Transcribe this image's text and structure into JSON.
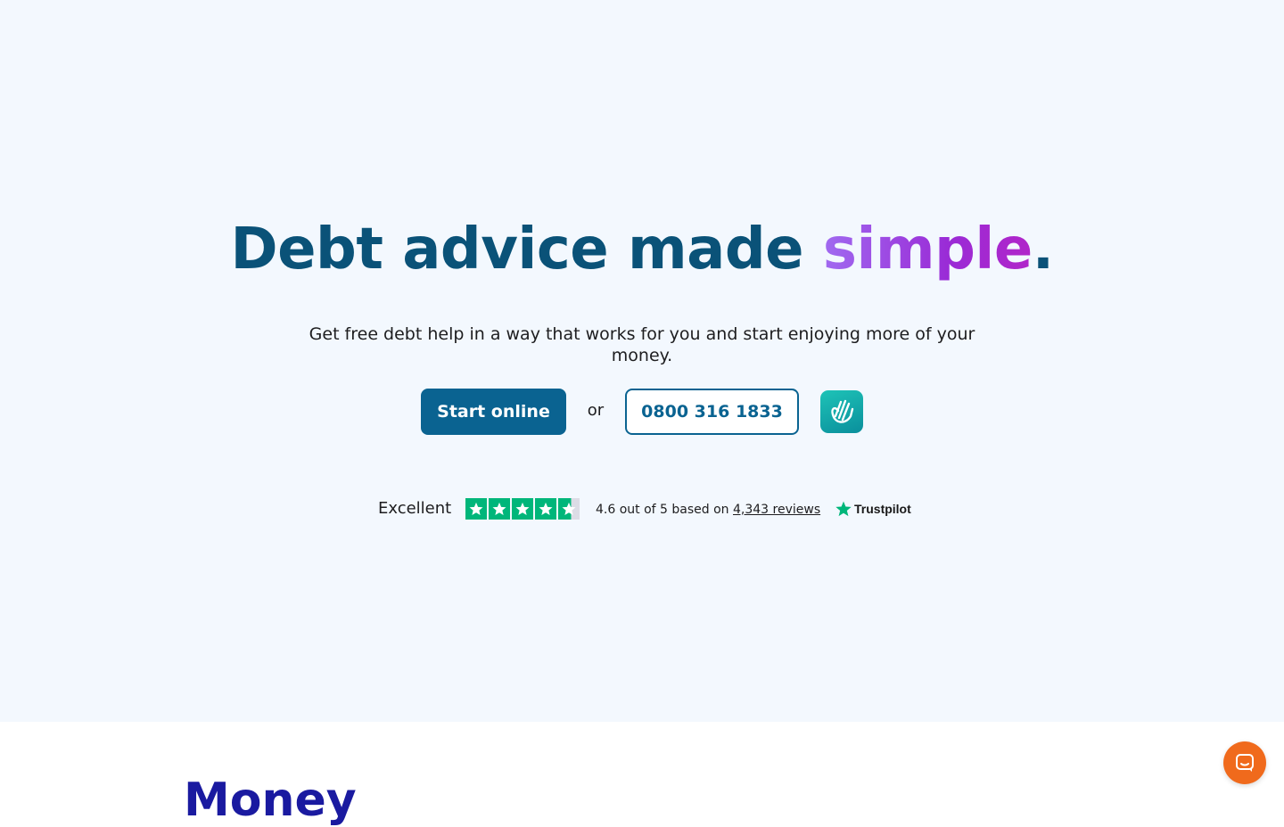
{
  "hero": {
    "headline_main": "Debt advice made ",
    "headline_accent": "simple",
    "headline_period": ".",
    "subtitle": "Get free debt help in a way that works for you and start enjoying more of your money.",
    "start_online_label": "Start online",
    "or_label": "or",
    "phone_label": "0800 316 1833",
    "app_badge_icon": "hand-logo-icon"
  },
  "trustpilot": {
    "rating_word": "Excellent",
    "stars_rating": 4.6,
    "stars_max": 5,
    "summary_prefix": "4.6 out of 5 based on ",
    "reviews_link": "4,343 reviews",
    "logo_text": "Trustpilot"
  },
  "next_section": {
    "heading_partial": "Money"
  },
  "chat": {
    "icon": "chat-bubble-icon"
  },
  "colors": {
    "brand_dark": "#0a5278",
    "button_primary": "#0a6391",
    "accent_purple": "#9a2bd6",
    "trustpilot_green": "#00b67a",
    "chat_orange": "#f06a1c",
    "hero_background": "#f3f8fe"
  }
}
